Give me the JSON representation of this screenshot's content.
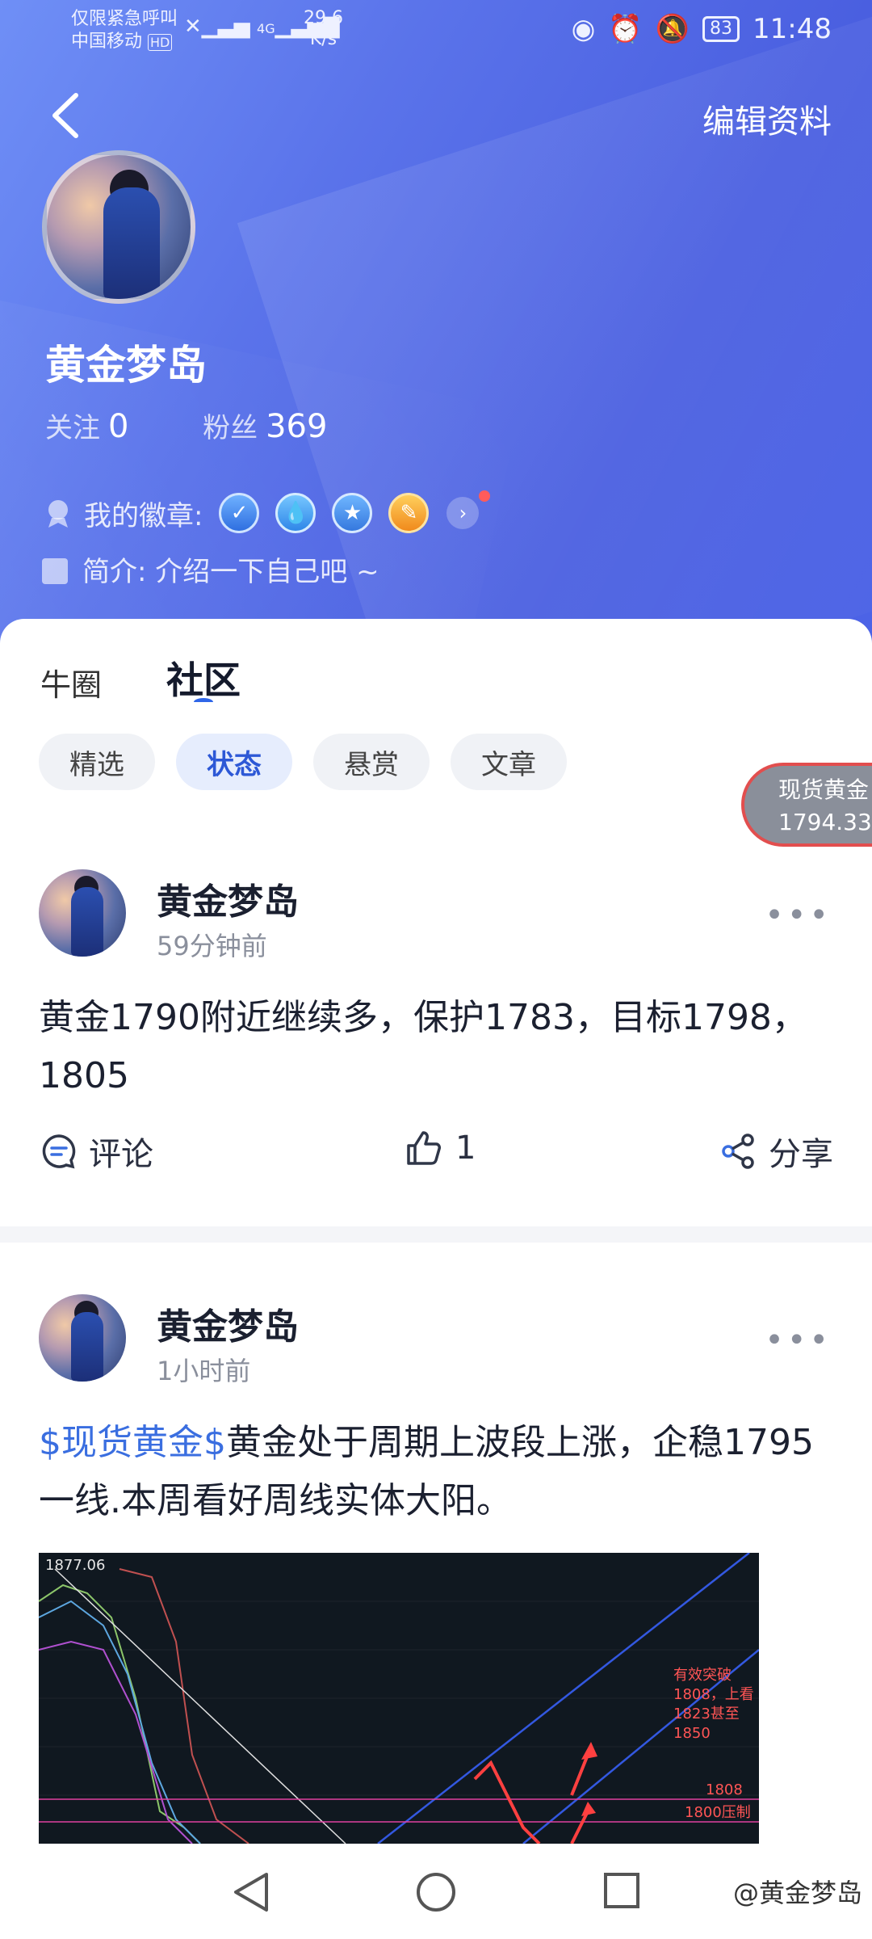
{
  "status_bar": {
    "carrier_line1": "仅限紧急呼叫",
    "carrier_line2": "中国移动",
    "hd": "HD",
    "net": "4G",
    "speed_value": "29.6",
    "speed_unit": "K/s",
    "battery": "83",
    "time": "11:48"
  },
  "header": {
    "edit_label": "编辑资料"
  },
  "profile": {
    "name": "黄金梦岛",
    "following_label": "关注",
    "following_count": "0",
    "followers_label": "粉丝",
    "followers_count": "369",
    "badges_label": "我的徽章:",
    "intro_label": "简介:",
    "intro_text": "介绍一下自己吧 ~"
  },
  "tabs": [
    {
      "label": "牛圈"
    },
    {
      "label": "社区"
    }
  ],
  "chips": [
    {
      "label": "精选"
    },
    {
      "label": "状态"
    },
    {
      "label": "悬赏"
    },
    {
      "label": "文章"
    }
  ],
  "floating_quote": {
    "name": "现货黄金",
    "price": "1794.33"
  },
  "posts": [
    {
      "author": "黄金梦岛",
      "time": "59分钟前",
      "text": "黄金1790附近继续多，保护1783，目标1798，1805",
      "comment_label": "评论",
      "like_count": "1",
      "share_label": "分享"
    },
    {
      "author": "黄金梦岛",
      "time": "1小时前",
      "tag": "$现货黄金$",
      "text": "黄金处于周期上波段上涨，企稳1795一线.本周看好周线实体大阳。",
      "chart_labels": {
        "top_price": "1877.06",
        "note_line1": "有效突破",
        "note_line2": "1808，上看",
        "note_line3": "1823甚至",
        "note_line4": "1850",
        "level1": "1808",
        "level2": "1800压制"
      }
    }
  ],
  "watermark": "@黄金梦岛"
}
